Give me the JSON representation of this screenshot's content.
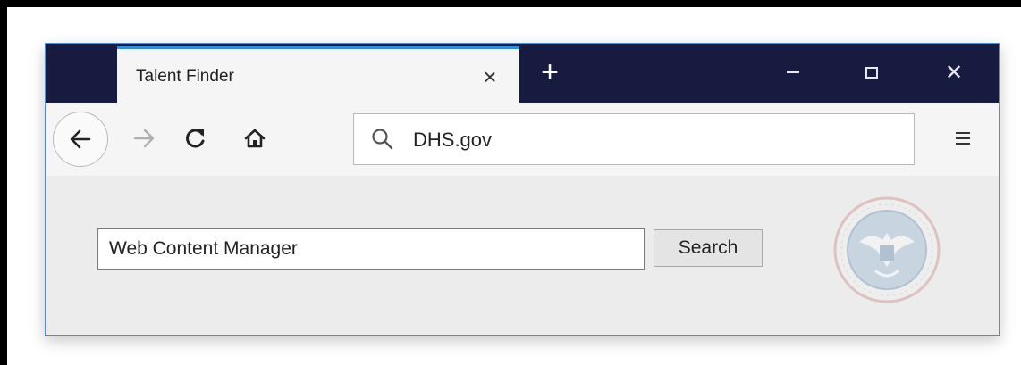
{
  "browser": {
    "tab": {
      "title": "Talent Finder",
      "close_glyph": "×"
    },
    "new_tab_glyph": "+",
    "window_controls": [
      "minimize-icon",
      "maximize-icon",
      "close-icon"
    ],
    "close_glyph": "✕"
  },
  "toolbar": {
    "icons": [
      "back-arrow-icon",
      "forward-arrow-icon",
      "reload-icon",
      "home-icon",
      "search-icon",
      "hamburger-menu-icon"
    ],
    "url": "DHS.gov"
  },
  "page": {
    "search_value": "Web Content Manager",
    "search_button": "Search",
    "seal_icon": "dhs-seal-watermark"
  },
  "colors": {
    "titlebar": "#171b40",
    "tab_accent": "#2e8ee6",
    "window_border": "#4a8fd8"
  }
}
